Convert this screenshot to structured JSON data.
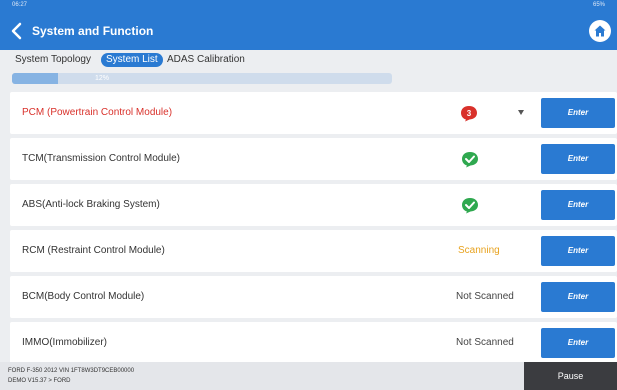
{
  "status_bar": {
    "time": "06:27",
    "battery": "65%"
  },
  "header": {
    "title": "System and Function"
  },
  "tabs": [
    {
      "label": "System Topology"
    },
    {
      "label": "System List"
    },
    {
      "label": "ADAS Calibration"
    }
  ],
  "progress": {
    "label": "12%",
    "value": 0.12
  },
  "systems": [
    {
      "name": "PCM (Powertrain Control Module)",
      "error_count": "3",
      "button": "Enter"
    },
    {
      "name": "TCM(Transmission Control Module)",
      "button": "Enter"
    },
    {
      "name": "ABS(Anti-lock Braking System)",
      "button": "Enter"
    },
    {
      "name": "RCM (Restraint Control Module)",
      "status": "Scanning",
      "button": "Enter"
    },
    {
      "name": "BCM(Body Control Module)",
      "status": "Not Scanned",
      "button": "Enter"
    },
    {
      "name": "IMMO(Immobilizer)",
      "status": "Not Scanned",
      "button": "Enter"
    }
  ],
  "footer": {
    "vehicle_line": "FORD  F-350  2012  VIN  1FT8W3DT9CEB00000",
    "version_line": "DEMO V15.37 > FORD",
    "pause_label": "Pause"
  },
  "colors": {
    "accent": "#2a7ad2",
    "error": "#d9312b",
    "ok": "#2fa84f",
    "scanning": "#e8a320"
  }
}
